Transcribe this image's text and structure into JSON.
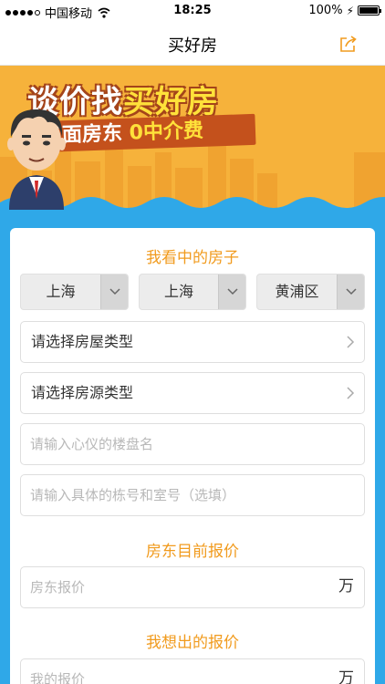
{
  "status_bar": {
    "carrier": "中国移动",
    "time": "18:25",
    "battery": "100%"
  },
  "nav": {
    "title": "买好房"
  },
  "banner": {
    "line1_a": "谈价找",
    "line1_b": "买好房",
    "line2_a": "直面房东",
    "line2_b": "0中介费"
  },
  "form": {
    "section_house": "我看中的房子",
    "city_select": "上海",
    "city2_select": "上海",
    "district_select": "黄浦区",
    "house_type_label": "请选择房屋类型",
    "source_type_label": "请选择房源类型",
    "building_placeholder": "请输入心仪的楼盘名",
    "room_placeholder": "请输入具体的栋号和室号（选填）",
    "section_owner_price": "房东目前报价",
    "owner_price_placeholder": "房东报价",
    "owner_price_unit": "万",
    "section_my_price": "我想出的报价",
    "my_price_placeholder": "我的报价",
    "my_price_unit": "万"
  },
  "colors": {
    "accent": "#f19b1e",
    "banner_bg": "#f6b23b",
    "page_bg": "#2fa8e8"
  }
}
